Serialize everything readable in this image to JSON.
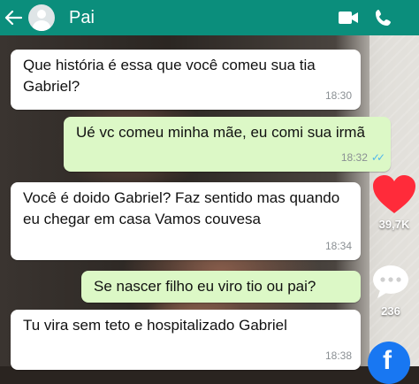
{
  "header": {
    "back_icon": "back-arrow-icon",
    "contact_name": "Pai",
    "video_icon": "video-call-icon",
    "call_icon": "phone-icon",
    "bg_color": "#0b8e7c"
  },
  "messages": [
    {
      "direction": "incoming",
      "text": "Que história é essa que você comeu sua tia Gabriel?",
      "time": "18:30"
    },
    {
      "direction": "outgoing",
      "text": "Ué vc comeu minha mãe, eu comi sua irmã",
      "time": "18:32",
      "status": "read"
    },
    {
      "direction": "incoming",
      "text": "Você é doido Gabriel? Faz sentido mas quando eu chegar em casa Vamos couvesa",
      "time": "18:34"
    },
    {
      "direction": "outgoing",
      "text": "Se nascer filho eu viro tio ou pai?",
      "time": ""
    },
    {
      "direction": "incoming",
      "text": "Tu vira sem teto e hospitalizado Gabriel",
      "time": "18:38"
    }
  ],
  "overlay": {
    "like_icon": "heart-icon",
    "like_count": "39,7K",
    "comment_icon": "comment-dots-icon",
    "comment_count": "236",
    "share_icon": "facebook-icon"
  },
  "colors": {
    "incoming_bubble": "#ffffff",
    "outgoing_bubble": "#dcf8c6",
    "read_ticks": "#4fb6ec",
    "heart": "#ff2b3a",
    "facebook": "#1877f2"
  }
}
